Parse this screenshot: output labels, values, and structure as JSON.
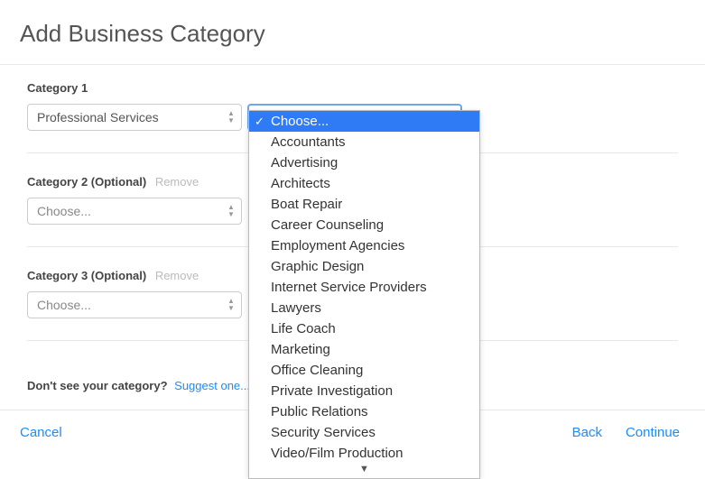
{
  "header": {
    "title": "Add Business Category"
  },
  "categories": [
    {
      "label": "Category 1",
      "remove": "",
      "value": "Professional Services",
      "placeholder": ""
    },
    {
      "label": "Category 2 (Optional)",
      "remove": "Remove",
      "value": "",
      "placeholder": "Choose..."
    },
    {
      "label": "Category 3 (Optional)",
      "remove": "Remove",
      "value": "",
      "placeholder": "Choose..."
    }
  ],
  "dropdown": {
    "selected": "Choose...",
    "options": [
      "Choose...",
      "Accountants",
      "Advertising",
      "Architects",
      "Boat Repair",
      "Career Counseling",
      "Employment Agencies",
      "Graphic Design",
      "Internet Service Providers",
      "Lawyers",
      "Life Coach",
      "Marketing",
      "Office Cleaning",
      "Private Investigation",
      "Public Relations",
      "Security Services",
      "Video/Film Production"
    ]
  },
  "suggest": {
    "prompt": "Don't see your category?",
    "link": "Suggest one..."
  },
  "footer": {
    "cancel": "Cancel",
    "back": "Back",
    "continue": "Continue"
  }
}
